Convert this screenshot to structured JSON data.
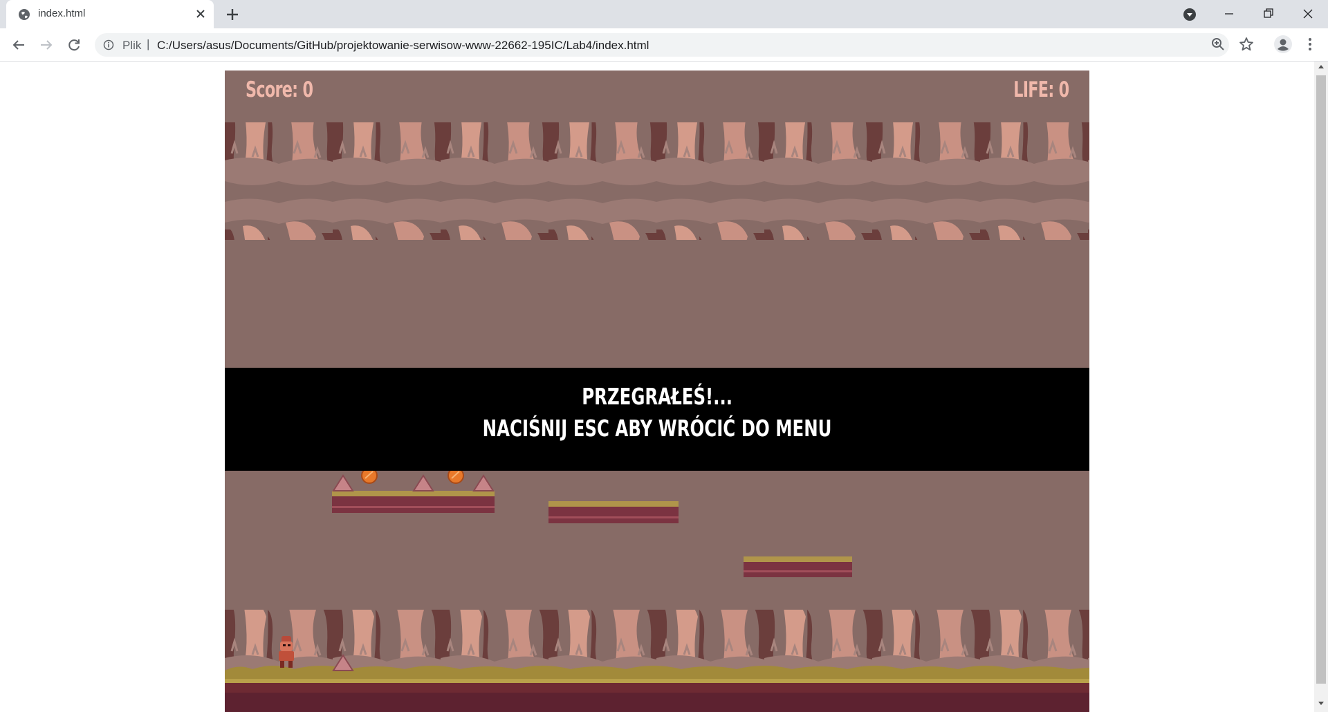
{
  "browser": {
    "tab_title": "index.html",
    "url_scheme": "Plik",
    "url_separator": "|",
    "url": "C:/Users/asus/Documents/GitHub/projektowanie-serwisow-www-22662-195IC/Lab4/index.html",
    "icons": {
      "favicon": "globe-icon",
      "tab_close": "close-icon",
      "new_tab": "plus-icon",
      "tab_search": "tab-search-icon",
      "back": "arrow-left-icon",
      "forward": "arrow-right-icon",
      "reload": "reload-icon",
      "site_info": "info-icon",
      "zoom": "zoom-icon",
      "bookmark": "star-icon",
      "profile": "profile-icon",
      "menu": "kebab-menu-icon"
    }
  },
  "game": {
    "hud": {
      "score_text": "Score: 0",
      "life_text": "LIFE: 0"
    },
    "overlay": {
      "title": "PRZEGRAŁEŚ!...",
      "message": "NACIŚNIJ ESC ABY WRÓCIĆ DO MENU"
    },
    "colors": {
      "sky": "#876b66",
      "hud_text": "#f0b8ab",
      "overlay_bg": "#000000",
      "overlay_text": "#ffffff",
      "ground_top": "#a28a3a",
      "ground_body": "#6e2a33",
      "coin": "#e8792a",
      "spike": "#c68488"
    }
  }
}
